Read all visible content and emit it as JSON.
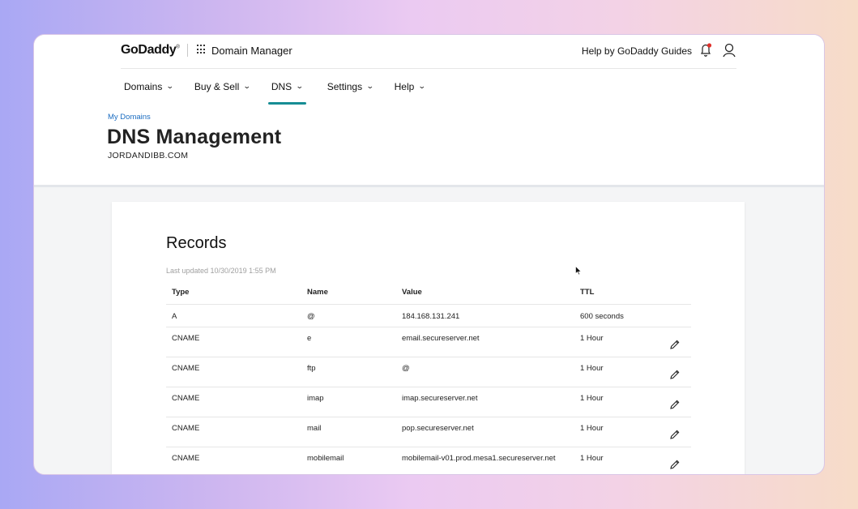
{
  "header": {
    "logo": "GoDaddy",
    "logo_mark": "®",
    "app_title": "Domain Manager",
    "help_link": "Help by GoDaddy Guides"
  },
  "nav": {
    "items": [
      {
        "label": "Domains"
      },
      {
        "label": "Buy & Sell"
      },
      {
        "label": "DNS"
      },
      {
        "label": "Settings"
      },
      {
        "label": "Help"
      }
    ],
    "active": "DNS"
  },
  "page": {
    "breadcrumb": "My Domains",
    "title": "DNS Management",
    "domain": "JORDANDIBB.COM"
  },
  "records": {
    "title": "Records",
    "last_updated": "Last updated 10/30/2019 1:55 PM",
    "columns": [
      "Type",
      "Name",
      "Value",
      "TTL"
    ],
    "rows": [
      {
        "type": "A",
        "name": "@",
        "value": "184.168.131.241",
        "ttl": "600 seconds"
      },
      {
        "type": "CNAME",
        "name": "e",
        "value": "email.secureserver.net",
        "ttl": "1 Hour"
      },
      {
        "type": "CNAME",
        "name": "ftp",
        "value": "@",
        "ttl": "1 Hour"
      },
      {
        "type": "CNAME",
        "name": "imap",
        "value": "imap.secureserver.net",
        "ttl": "1 Hour"
      },
      {
        "type": "CNAME",
        "name": "mail",
        "value": "pop.secureserver.net",
        "ttl": "1 Hour"
      },
      {
        "type": "CNAME",
        "name": "mobilemail",
        "value": "mobilemail-v01.prod.mesa1.secureserver.net",
        "ttl": "1 Hour"
      }
    ]
  },
  "colors": {
    "accent": "#168d94",
    "link": "#1b6dc1",
    "notification": "#e0312b"
  }
}
